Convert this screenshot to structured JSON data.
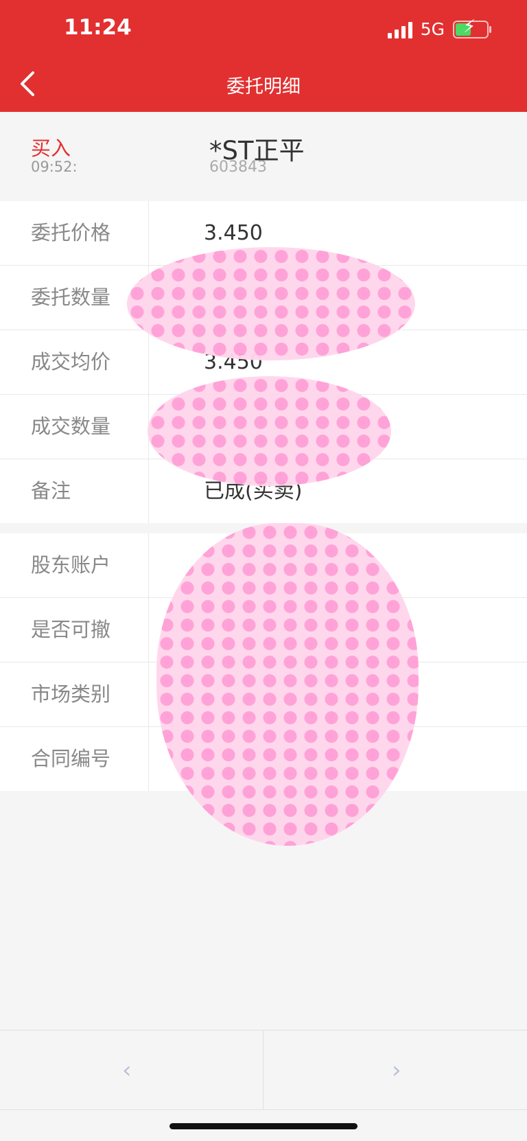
{
  "status_bar": {
    "time": "11:24",
    "network": "5G"
  },
  "nav": {
    "title": "委托明细"
  },
  "order": {
    "side": "买入",
    "time": "09:52:",
    "stock_name": "*ST正平",
    "stock_code": "603843"
  },
  "details": [
    {
      "label": "委托价格",
      "value": "3.450"
    },
    {
      "label": "委托数量",
      "value": ""
    },
    {
      "label": "成交均价",
      "value": "3.450"
    },
    {
      "label": "成交数量",
      "value": ""
    },
    {
      "label": "备注",
      "value": "已成(买卖)"
    }
  ],
  "account": [
    {
      "label": "股东账户",
      "value": ""
    },
    {
      "label": "是否可撤",
      "value": ""
    },
    {
      "label": "市场类别",
      "value": ""
    },
    {
      "label": "合同编号",
      "value": ""
    }
  ],
  "pager": {
    "prev_icon": "chevron-left-icon",
    "next_icon": "chevron-right-icon"
  },
  "colors": {
    "header": "#e23030",
    "buy": "#e23030",
    "background": "#f5f5f5"
  }
}
